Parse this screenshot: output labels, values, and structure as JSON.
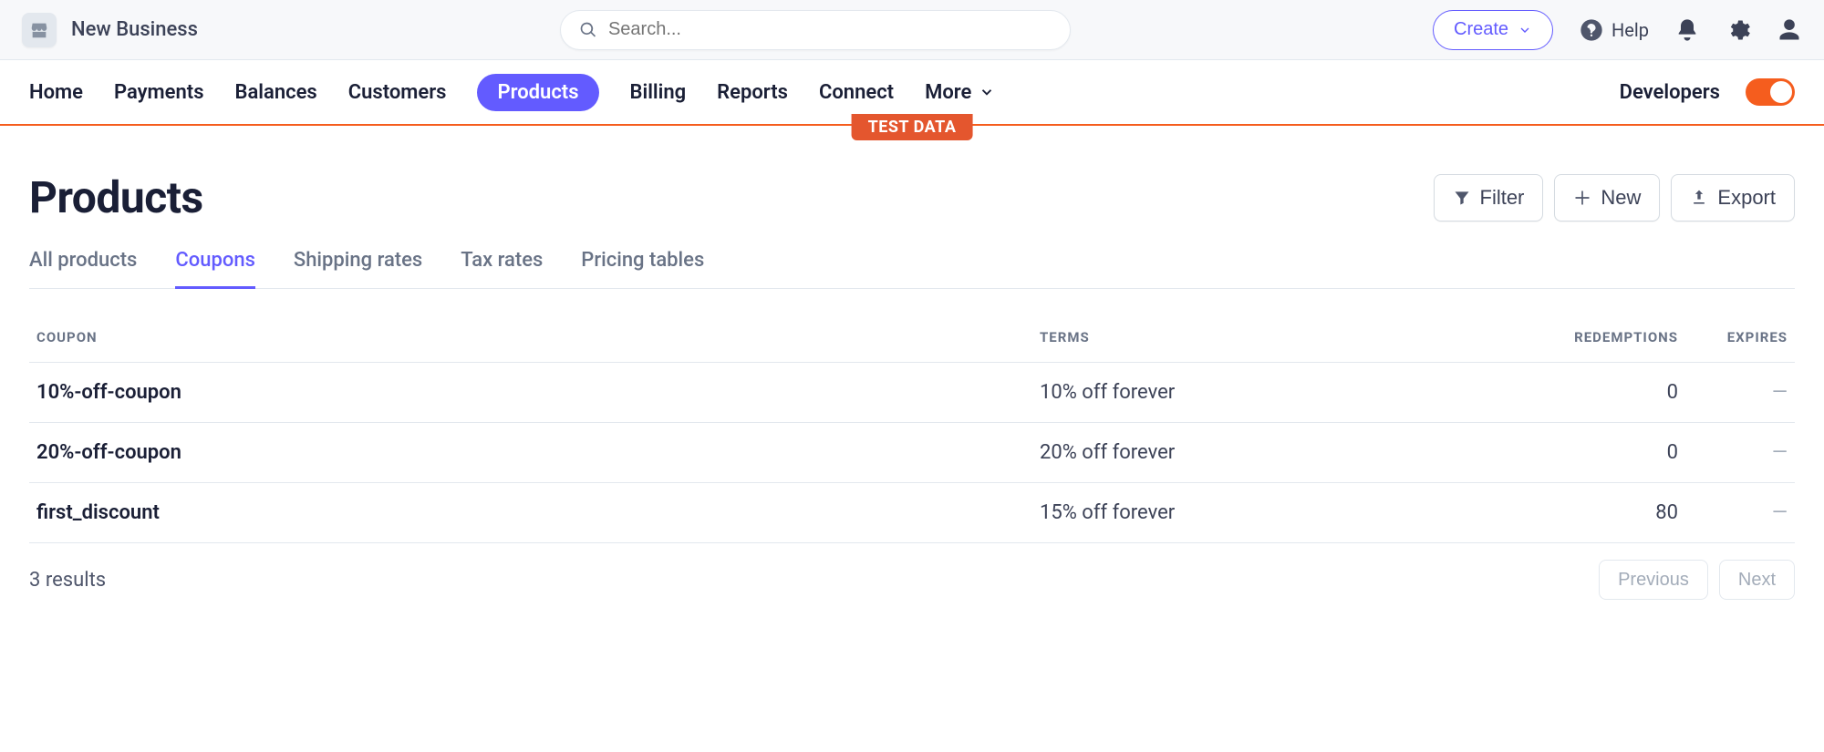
{
  "topbar": {
    "business_name": "New Business",
    "search_placeholder": "Search...",
    "create_label": "Create",
    "help_label": "Help"
  },
  "nav": {
    "items": [
      "Home",
      "Payments",
      "Balances",
      "Customers",
      "Products",
      "Billing",
      "Reports",
      "Connect",
      "More"
    ],
    "active_index": 4,
    "developers_label": "Developers",
    "test_mode": true,
    "test_badge": "TEST DATA"
  },
  "page": {
    "title": "Products",
    "actions": {
      "filter": "Filter",
      "new": "New",
      "export": "Export"
    }
  },
  "subtabs": {
    "items": [
      "All products",
      "Coupons",
      "Shipping rates",
      "Tax rates",
      "Pricing tables"
    ],
    "active_index": 1
  },
  "table": {
    "columns": [
      "COUPON",
      "TERMS",
      "REDEMPTIONS",
      "EXPIRES"
    ],
    "rows": [
      {
        "name": "10%-off-coupon",
        "terms": "10% off forever",
        "redemptions": "0",
        "expires": "—"
      },
      {
        "name": "20%-off-coupon",
        "terms": "20% off forever",
        "redemptions": "0",
        "expires": "—"
      },
      {
        "name": "first_discount",
        "terms": "15% off forever",
        "redemptions": "80",
        "expires": "—"
      }
    ],
    "results_text": "3 results",
    "prev_label": "Previous",
    "next_label": "Next"
  }
}
